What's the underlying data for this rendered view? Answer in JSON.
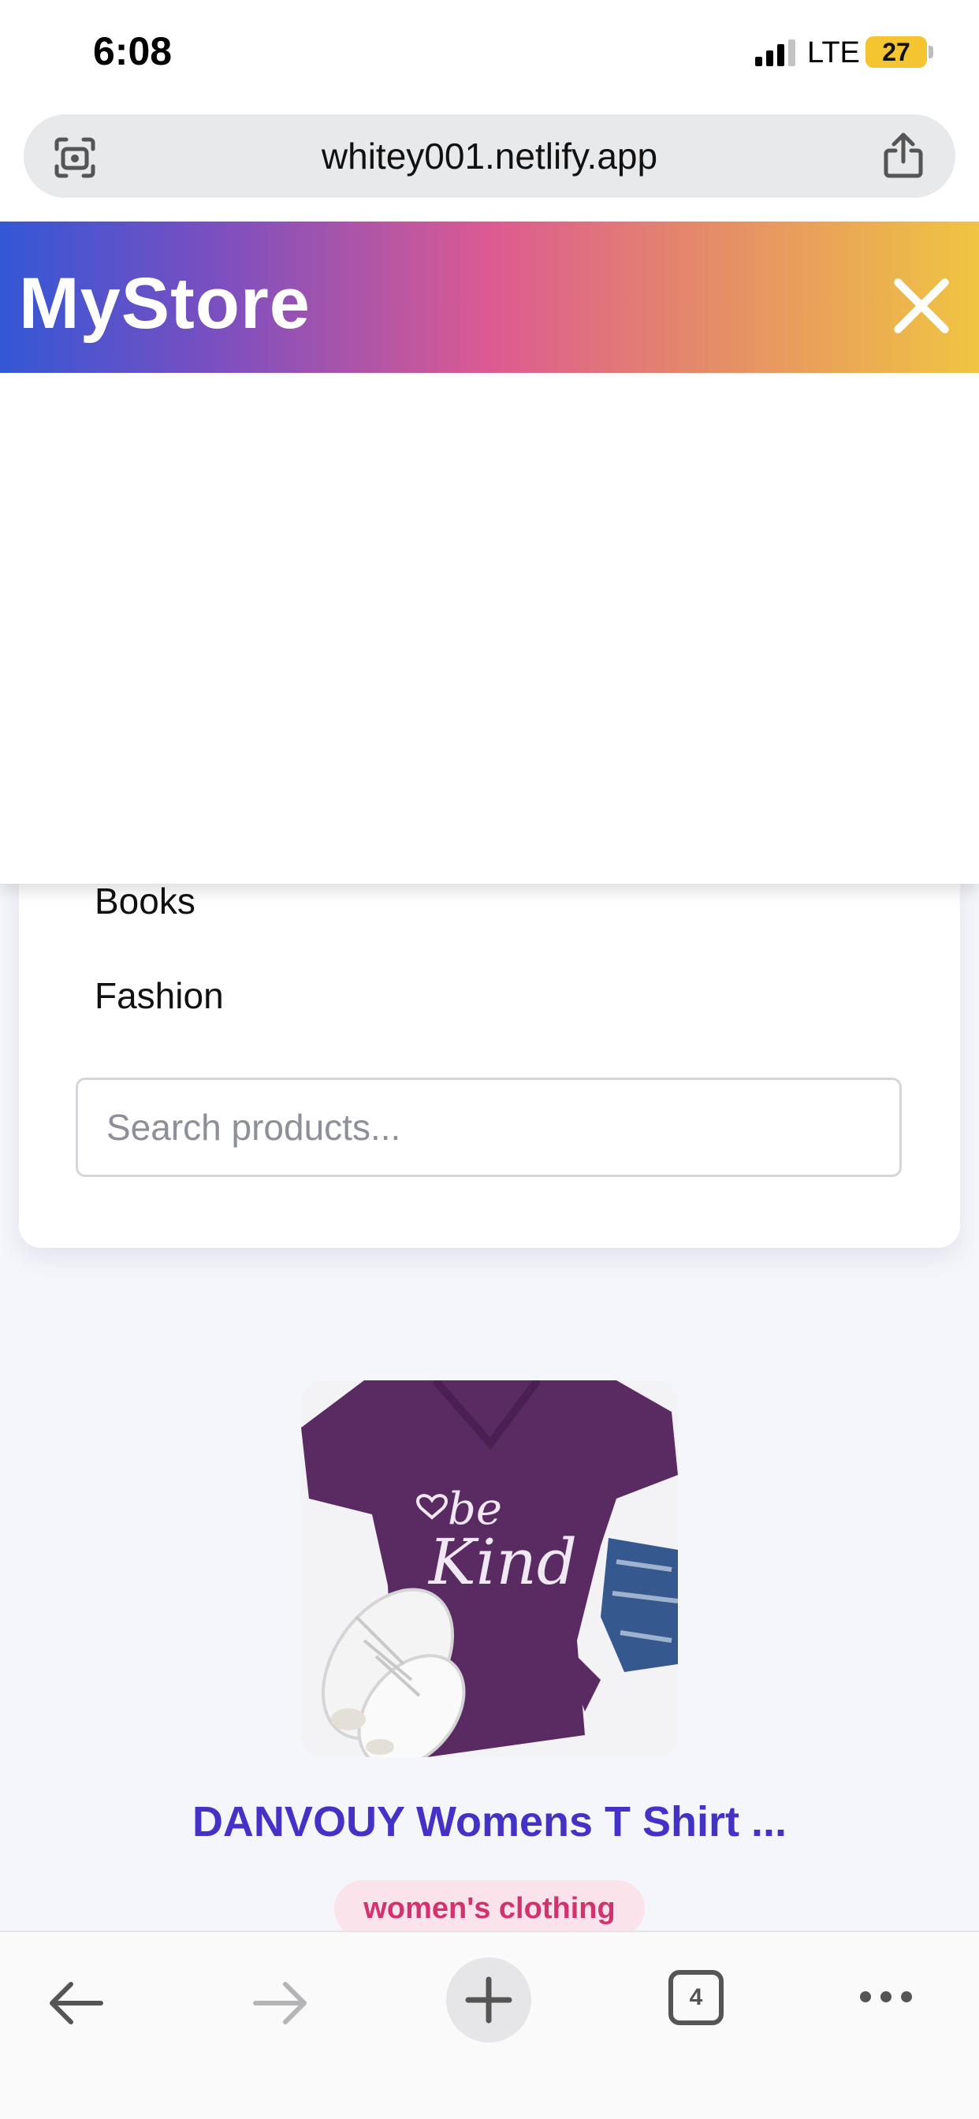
{
  "status_bar": {
    "time": "6:08",
    "network": "LTE",
    "battery": "27"
  },
  "browser": {
    "url": "whitey001.netlify.app",
    "toolbar": {
      "tabs_count": "4"
    }
  },
  "store": {
    "brand": "MyStore",
    "menu": {
      "items": [
        "Books",
        "Fashion"
      ]
    },
    "search": {
      "placeholder": "Search products..."
    }
  },
  "product": {
    "title": "DANVOUY Womens T Shirt ...",
    "category": "women's clothing",
    "image_text": [
      "be",
      "Kind"
    ]
  },
  "colors": {
    "brand_gradient": [
      "#3457d5",
      "#dc5a92",
      "#f0c542"
    ],
    "title": "#4431c6",
    "badge_bg": "#fbe3ec",
    "badge_text": "#d2336f"
  },
  "icons": [
    "lens-icon",
    "share-icon",
    "close-icon",
    "back-arrow-icon",
    "forward-arrow-icon",
    "plus-icon",
    "tabs-icon",
    "more-icon"
  ]
}
